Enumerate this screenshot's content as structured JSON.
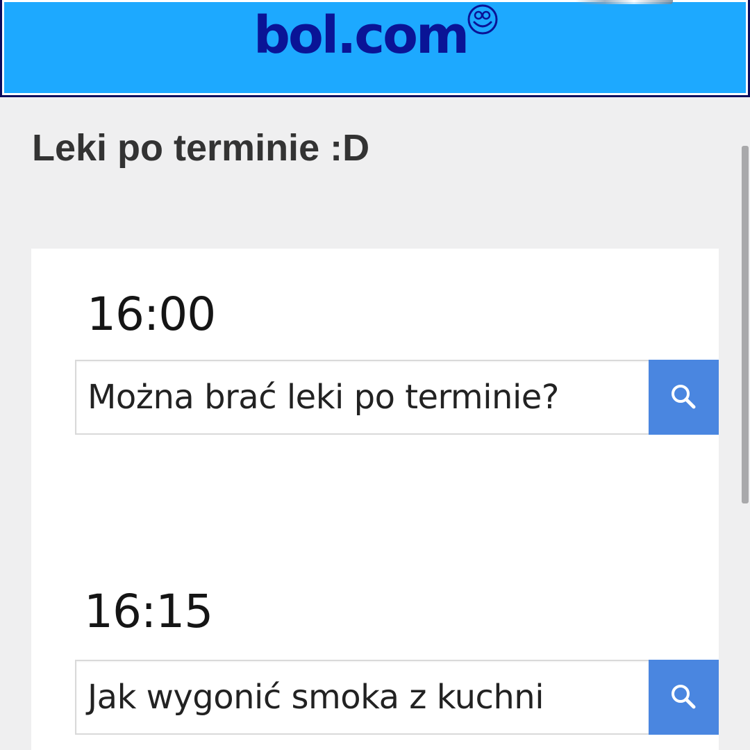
{
  "banner": {
    "logo_text": "bol.com",
    "logo_icon": "smile-icon",
    "colors": {
      "background": "#1da9ff",
      "logo": "#0a1496",
      "border": "#0a0a5c"
    }
  },
  "post": {
    "title": "Leki po terminie :D"
  },
  "meme": {
    "entries": [
      {
        "time": "16:00",
        "query": "Można brać leki po terminie?",
        "button_icon": "search-icon"
      },
      {
        "time": "16:15",
        "query": "Jak wygonić smoka z kuchni",
        "button_icon": "search-icon"
      }
    ],
    "colors": {
      "search_button": "#4a86e0",
      "background": "#ffffff"
    }
  },
  "page": {
    "background": "#efeff0",
    "title_color": "#333333"
  }
}
